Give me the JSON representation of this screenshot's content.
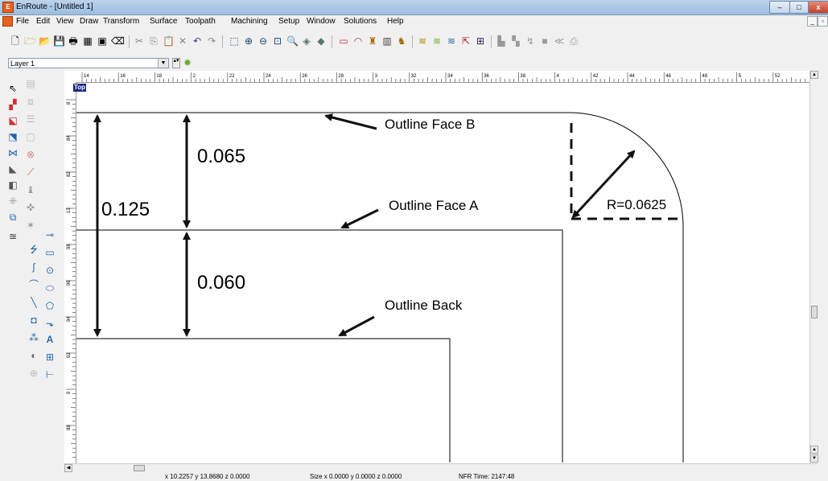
{
  "window": {
    "title": "EnRoute - [Untitled 1]",
    "app_icon_letter": "E",
    "min_glyph": "–",
    "max_glyph": "□",
    "close_glyph": "x"
  },
  "menu": {
    "items": [
      "File",
      "Edit",
      "View",
      "Draw",
      "Transform",
      "Surface",
      "Toolpath",
      "Machining",
      "Setup",
      "Window",
      "Solutions",
      "Help"
    ],
    "mdi_min": "_",
    "mdi_restore": "▫"
  },
  "layer": {
    "selected": "Layer 1",
    "arrow": "▼",
    "spin": "▴▾"
  },
  "view_badge": "Top",
  "ruler": {
    "h_labels": [
      "14",
      "16",
      "18",
      "2",
      "22",
      "24",
      "26",
      "28",
      "3",
      "32",
      "34",
      "36",
      "38",
      "4",
      "42",
      "44",
      "46",
      "48",
      "5",
      "52"
    ],
    "v_labels": [
      "8",
      "84",
      "82",
      "13",
      "98",
      "96",
      "94",
      "92",
      "9",
      "88"
    ]
  },
  "annotations": {
    "outline_face_b": "Outline Face B",
    "outline_face_a": "Outline Face A",
    "outline_back": "Outline Back",
    "dim_top": "0.065",
    "dim_total": "0.125",
    "dim_bottom": "0.060",
    "radius": "R=0.0625"
  },
  "status": {
    "coords": "x 10.2257  y 13.8680  z 0.0000",
    "size": "Size x 0.0000  y 0.0000  z 0.0000",
    "nfr": "NFR Time: 2147:48"
  },
  "toolbar": {
    "icons": [
      "new-icon",
      "open-icon",
      "open-folder-icon",
      "save-icon",
      "print-icon",
      "grid-icon",
      "screen-icon",
      "eraser-icon",
      "cut-icon",
      "copy-icon",
      "paste-icon",
      "delete-icon",
      "undo-icon",
      "redo-icon",
      "select-box-icon",
      "zoom-in-icon",
      "zoom-out-icon",
      "zoom-all-icon",
      "zoom-window-icon",
      "view3d-icon",
      "render-icon",
      "rectangle-icon",
      "arc-icon",
      "toolpath-icon",
      "machine-icon",
      "output-icon",
      "layers-icon",
      "layer-up-icon",
      "layer-down-icon",
      "pointer-icon",
      "table-icon",
      "fill-icon",
      "texture-icon",
      "vector-icon",
      "box-icon",
      "measure-icon",
      "camera-icon"
    ]
  }
}
